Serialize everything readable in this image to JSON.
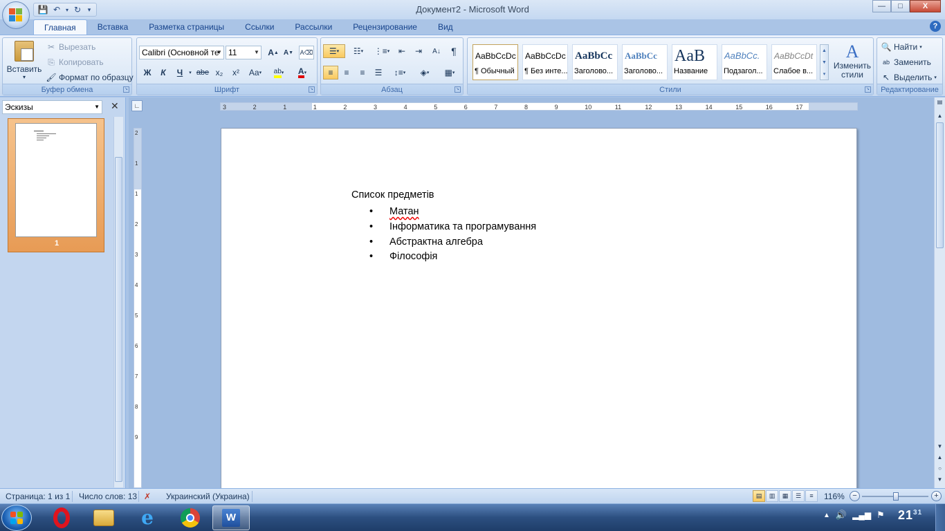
{
  "window": {
    "title": "Документ2 - Microsoft Word",
    "controls": {
      "minimize": "—",
      "maximize": "□",
      "close": "X"
    }
  },
  "qat": {
    "save_icon": "save-icon",
    "undo_icon": "undo-icon",
    "redo_icon": "redo-icon"
  },
  "tabs": [
    {
      "label": "Главная"
    },
    {
      "label": "Вставка"
    },
    {
      "label": "Разметка страницы"
    },
    {
      "label": "Ссылки"
    },
    {
      "label": "Рассылки"
    },
    {
      "label": "Рецензирование"
    },
    {
      "label": "Вид"
    }
  ],
  "ribbon": {
    "clipboard": {
      "label": "Буфер обмена",
      "paste": "Вставить",
      "cut": "Вырезать",
      "copy": "Копировать",
      "format_painter": "Формат по образцу"
    },
    "font": {
      "label": "Шрифт",
      "font_name": "Calibri (Основной те",
      "font_size": "11",
      "bold": "Ж",
      "italic": "К",
      "underline": "Ч",
      "strike": "abe",
      "subscript": "x₂",
      "superscript": "x²",
      "change_case": "Aa",
      "grow": "A",
      "shrink": "A",
      "font_color": "A"
    },
    "paragraph": {
      "label": "Абзац",
      "pilcrow": "¶"
    },
    "styles": {
      "label": "Стили",
      "items": [
        {
          "sample": "AaBbCcDc",
          "name": "¶ Обычный"
        },
        {
          "sample": "AaBbCcDc",
          "name": "¶ Без инте..."
        },
        {
          "sample": "AaBbCc",
          "name": "Заголово..."
        },
        {
          "sample": "AaBbCc",
          "name": "Заголово..."
        },
        {
          "sample": "AaB",
          "name": "Название"
        },
        {
          "sample": "AaBbCc.",
          "name": "Подзагол..."
        },
        {
          "sample": "AaBbCcDt",
          "name": "Слабое в..."
        }
      ],
      "change_styles": "Изменить стили"
    },
    "editing": {
      "label": "Редактирование",
      "find": "Найти",
      "replace": "Заменить",
      "select": "Выделить"
    }
  },
  "thumbnails": {
    "select": "Эскизы",
    "page_number": "1"
  },
  "ruler": {
    "h_numbers": [
      "3",
      "2",
      "1",
      "1",
      "2",
      "3",
      "4",
      "5",
      "6",
      "7",
      "8",
      "9",
      "10",
      "11",
      "12",
      "13",
      "14",
      "15",
      "16",
      "17"
    ],
    "v_numbers": [
      "2",
      "1",
      "1",
      "2",
      "3",
      "4",
      "5",
      "6",
      "7",
      "8",
      "9"
    ]
  },
  "document": {
    "title": "Список предметів",
    "items": [
      {
        "text": "Матан"
      },
      {
        "text": "Інформатика та програмування"
      },
      {
        "text": "Абстрактна алгебра"
      },
      {
        "text": "Філософія"
      }
    ],
    "bullet": "•"
  },
  "status": {
    "page": "Страница: 1 из 1",
    "words": "Число слов: 13",
    "language": "Украинский (Украина)",
    "zoom": "116%",
    "zoom_level": 1.16
  },
  "taskbar": {
    "apps": [
      "opera",
      "explorer",
      "internet-explorer",
      "chrome",
      "word"
    ],
    "clock_hour": "21",
    "clock_min": "31"
  }
}
